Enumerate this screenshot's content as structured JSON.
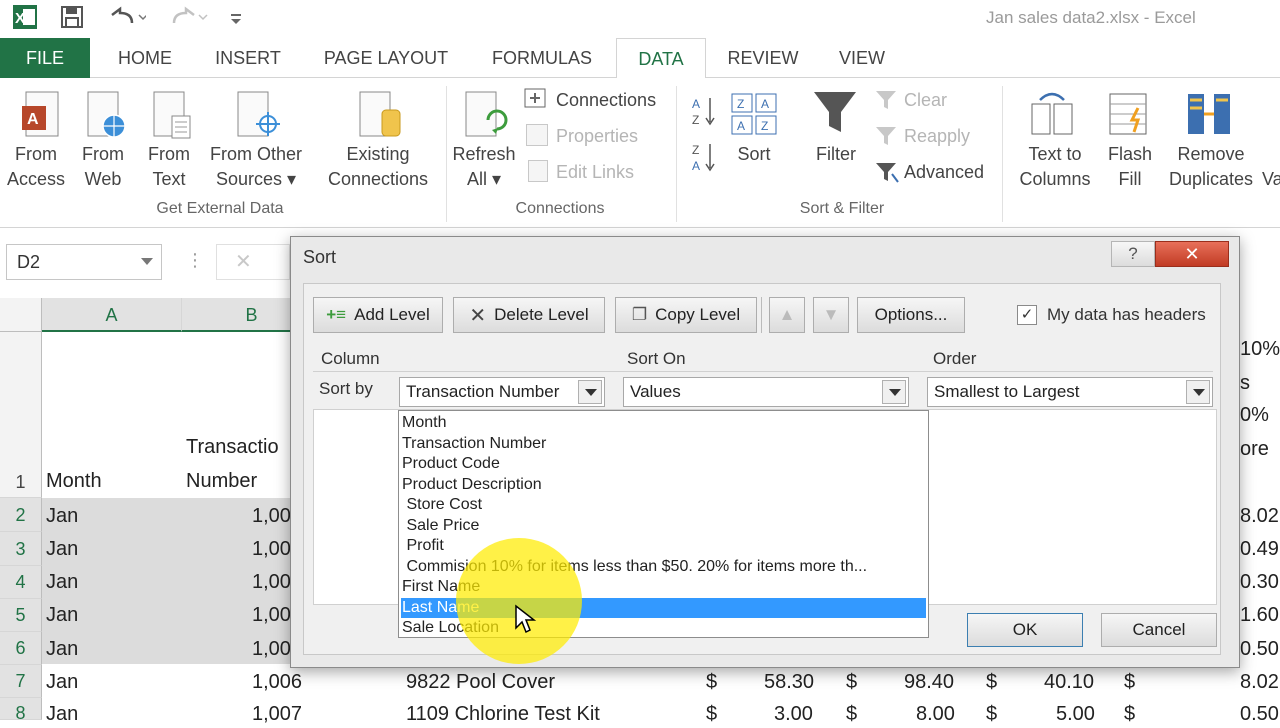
{
  "window": {
    "title": "Jan sales data2.xlsx - Excel"
  },
  "qat": {
    "icons": [
      "excel-logo-icon",
      "save-icon",
      "undo-icon",
      "redo-icon",
      "customize-qat-icon"
    ]
  },
  "tabs": [
    "FILE",
    "HOME",
    "INSERT",
    "PAGE LAYOUT",
    "FORMULAS",
    "DATA",
    "REVIEW",
    "VIEW"
  ],
  "ribbon": {
    "get_external": {
      "label": "Get External Data",
      "from_access": [
        "From",
        "Access"
      ],
      "from_web": [
        "From",
        "Web"
      ],
      "from_text": [
        "From",
        "Text"
      ],
      "from_other": [
        "From Other",
        "Sources ▾"
      ],
      "existing": [
        "Existing",
        "Connections"
      ]
    },
    "connections": {
      "label": "Connections",
      "refresh": [
        "Refresh",
        "All ▾"
      ],
      "connections": "Connections",
      "properties": "Properties",
      "edit_links": "Edit Links"
    },
    "sort_filter": {
      "label": "Sort & Filter",
      "sort": "Sort",
      "filter": "Filter",
      "clear": "Clear",
      "reapply": "Reapply",
      "advanced": "Advanced"
    },
    "data_tools": {
      "text_to_columns": [
        "Text to",
        "Columns"
      ],
      "flash_fill": [
        "Flash",
        "Fill"
      ],
      "remove_duplicates": [
        "Remove",
        "Duplicates"
      ],
      "cut_label": "Va"
    }
  },
  "namebox": {
    "value": "D2"
  },
  "grid": {
    "col_a": "A",
    "col_b": "B",
    "header_month": "Month",
    "header_trans_1": "Transactio",
    "header_trans_2": "Number",
    "rows": [
      {
        "num": "1",
        "month": "",
        "trans": ""
      },
      {
        "num": "2",
        "month": "Jan",
        "trans": "1,00"
      },
      {
        "num": "3",
        "month": "Jan",
        "trans": "1,00"
      },
      {
        "num": "4",
        "month": "Jan",
        "trans": "1,00"
      },
      {
        "num": "5",
        "month": "Jan",
        "trans": "1,00"
      },
      {
        "num": "6",
        "month": "Jan",
        "trans": "1,00"
      },
      {
        "num": "7",
        "month": "Jan",
        "trans": "1,006"
      },
      {
        "num": "8",
        "month": "Jan",
        "trans": "1,007"
      }
    ],
    "row7": {
      "product": "9822 Pool Cover",
      "d1": "$",
      "v1": "58.30",
      "d2": "$",
      "v2": "98.40",
      "d3": "$",
      "v3": "40.10",
      "d4": "$",
      "v4": "8.02"
    },
    "row8": {
      "product": "1109 Chlorine Test Kit",
      "d1": "$",
      "v1": "3.00",
      "d2": "$",
      "v2": "8.00",
      "d3": "$",
      "v3": "5.00",
      "d4": "$",
      "v4": "0.50"
    },
    "right_col": [
      "10%",
      "s",
      "0%",
      "ore",
      "8.02",
      "0.49",
      "0.30",
      "1.60",
      "0.50"
    ]
  },
  "dialog": {
    "title": "Sort",
    "help": "?",
    "close": "✕",
    "add_level": "Add Level",
    "delete_level": "Delete Level",
    "copy_level": "Copy Level",
    "options": "Options...",
    "my_data_has_headers": "My data has headers",
    "headers_checked": true,
    "col_header": "Column",
    "sort_on_header": "Sort On",
    "order_header": "Order",
    "sort_by": "Sort by",
    "column_value": "Transaction Number",
    "sort_on_value": "Values",
    "order_value": "Smallest to Largest",
    "ok": "OK",
    "cancel": "Cancel",
    "dropdown_items": [
      "Month",
      "Transaction Number",
      "Product Code",
      "Product Description",
      " Store Cost",
      " Sale Price",
      " Profit",
      " Commision 10% for items less than $50. 20% for items more th...",
      "First Name",
      "Last Name",
      "Sale Location"
    ],
    "selected_index": 9
  }
}
